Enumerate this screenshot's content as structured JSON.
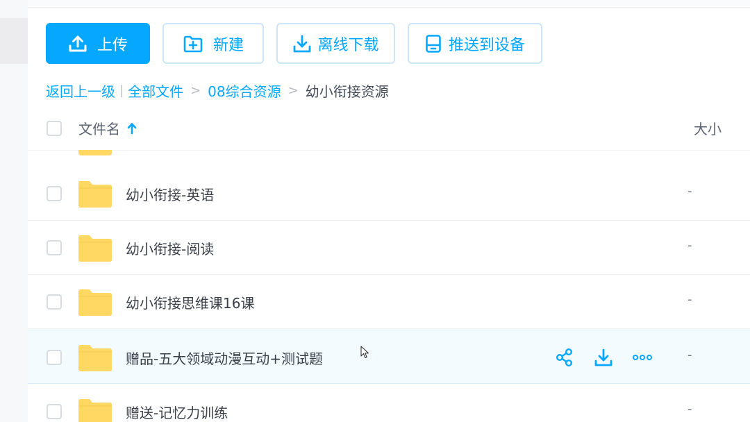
{
  "toolbar": {
    "upload_label": "上传",
    "new_label": "新建",
    "offline_label": "离线下载",
    "push_label": "推送到设备"
  },
  "breadcrumb": {
    "back_label": "返回上一级",
    "root_label": "全部文件",
    "parent_label": "08综合资源",
    "current_label": "幼小衔接资源",
    "separator": ">"
  },
  "table": {
    "name_header": "文件名",
    "size_header": "大小"
  },
  "files": [
    {
      "name": "幼小衔接-英语",
      "size": "-"
    },
    {
      "name": "幼小衔接-阅读",
      "size": "-"
    },
    {
      "name": "幼小衔接思维课16课",
      "size": "-"
    },
    {
      "name": "赠品-五大领域动漫互动+测试题",
      "size": "-"
    },
    {
      "name": "赠送-记忆力训练",
      "size": "-"
    }
  ],
  "colors": {
    "accent": "#06a7ff",
    "folder": "#ffd864"
  },
  "icons": {
    "upload": "upload-icon",
    "new": "folder-plus-icon",
    "offline": "download-icon",
    "push": "device-icon",
    "sort": "sort-ascending-arrow-icon",
    "share": "share-icon",
    "download": "download-icon",
    "more": "more-dots-icon"
  }
}
